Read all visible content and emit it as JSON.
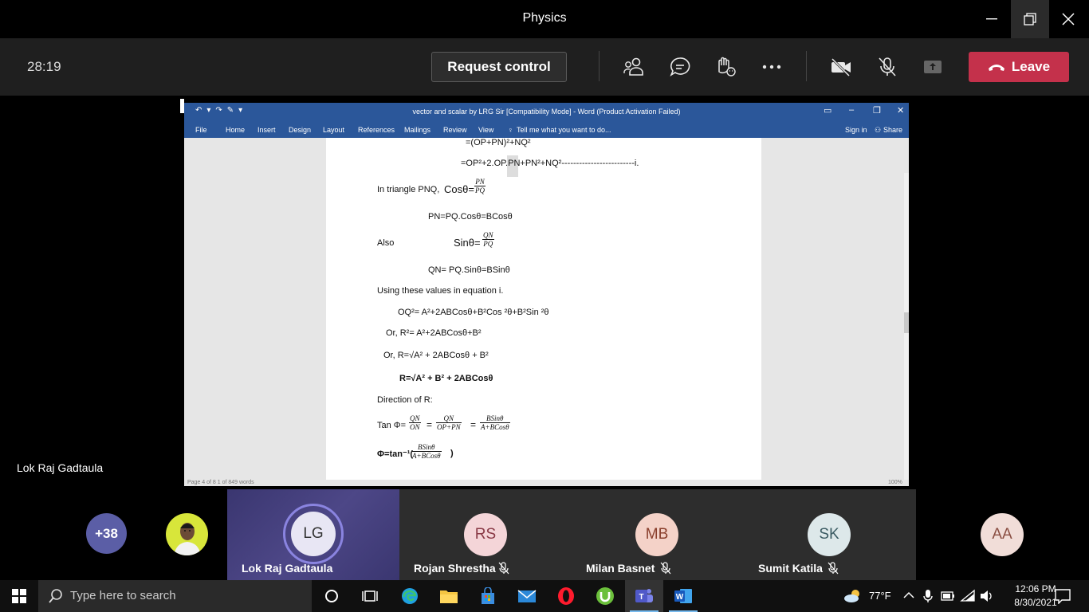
{
  "window": {
    "title": "Physics"
  },
  "meeting": {
    "timer": "28:19",
    "request_control_label": "Request control",
    "leave_label": "Leave",
    "presenter_name": "Lok Raj Gadtaula"
  },
  "word": {
    "title": "vector and scalar by LRG Sir [Compatibility Mode] - Word (Product Activation Failed)",
    "tabs": [
      "File",
      "Home",
      "Insert",
      "Design",
      "Layout",
      "References",
      "Mailings",
      "Review",
      "View"
    ],
    "tell_me": "Tell me what you want to do...",
    "sign_in": "Sign in",
    "share": "Share",
    "status": "Page 4 of 8     1 of 849 words",
    "zoom": "100%"
  },
  "doc": {
    "l1": "=(OP+PN)²+NQ²",
    "l2": "=OP²+2.OP.PN+PN²+NQ²-------------------------i.",
    "l3_prefix": "In triangle PNQ, ",
    "l3_func": "Cosθ=",
    "l3_num": "PN",
    "l3_den": "PQ",
    "l4": "PN=PQ.Cosθ=BCosθ",
    "l5_also": "Also",
    "l5_func": "Sinθ=",
    "l5_num": "QN",
    "l5_den": "PQ",
    "l6": "QN= PQ.Sinθ=BSinθ",
    "l7": "Using these values in equation i.",
    "l8": "OQ²= A²+2ABCosθ+B²Cos ²θ+B²Sin ²θ",
    "l9": "Or, R²= A²+2ABCosθ+B²",
    "l10": "Or, R=√A² + 2ABCosθ + B²",
    "l11": "R=√A² + B² + 2ABCosθ",
    "l12": "Direction of R:",
    "l13_prefix": "Tan Φ=",
    "l13_f1_num": "QN",
    "l13_f1_den": "ON",
    "l13_f2_num": "QN",
    "l13_f2_den": "OP+PN",
    "l13_f3_num": "BSinθ",
    "l13_f3_den": "A+BCosθ",
    "l13_eq": "=",
    "l14_prefix": "Φ=tan⁻¹(",
    "l14_num": "BSinθ",
    "l14_den": "A+BCosθ",
    "l14_suffix": ")"
  },
  "participants": {
    "overflow": "+38",
    "tiles": [
      {
        "initials": "LG",
        "name": "Lok Raj Gadtaula",
        "color": "#e8e6f4"
      },
      {
        "initials": "RS",
        "name": "Rojan Shrestha",
        "color": "#f4d5d8"
      },
      {
        "initials": "MB",
        "name": "Milan Basnet",
        "color": "#f4d2c8"
      },
      {
        "initials": "SK",
        "name": "Sumit Katila",
        "color": "#dde8ea"
      },
      {
        "initials": "AA",
        "name": "",
        "color": "#f1ddd8"
      }
    ]
  },
  "taskbar": {
    "search_placeholder": "Type here to search",
    "weather": "77°F",
    "time": "12:06 PM",
    "date": "8/30/2021"
  },
  "colors": {
    "leave": "#c4314b",
    "word_blue": "#2b579a",
    "overflow_badge": "#5b5ea6"
  }
}
